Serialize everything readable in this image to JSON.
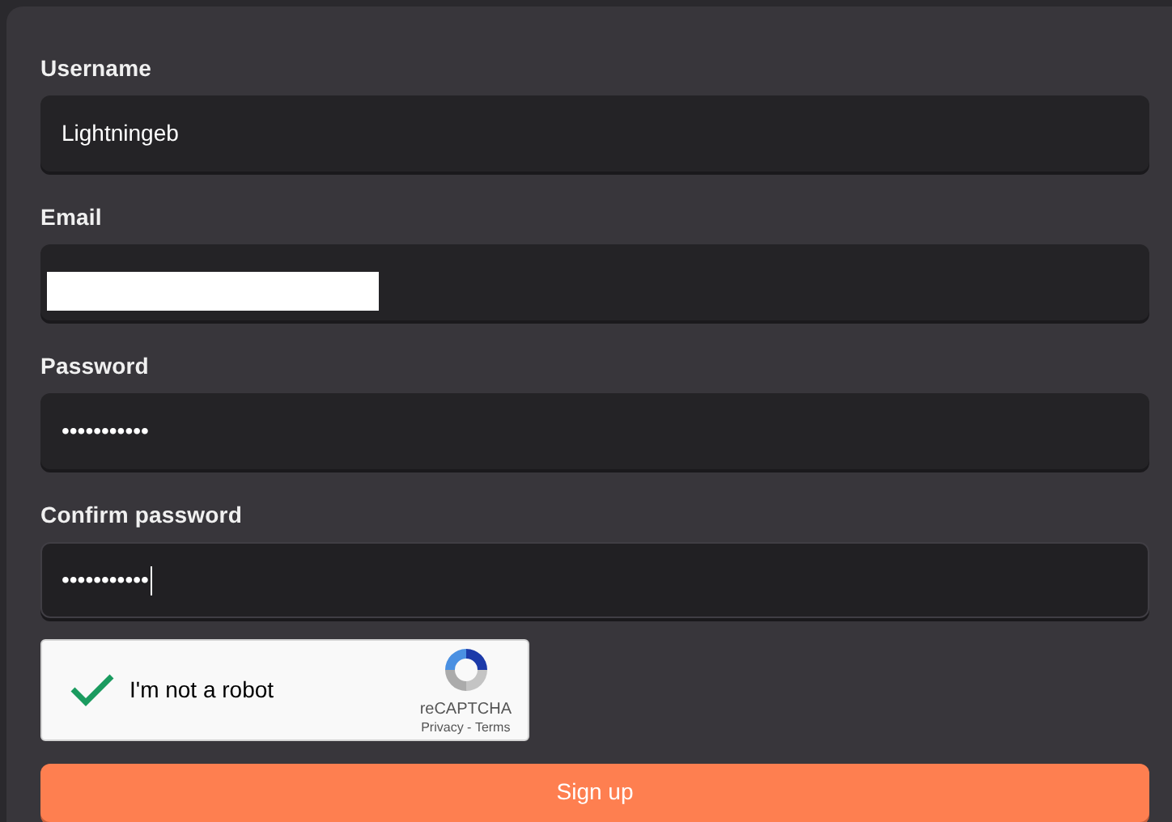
{
  "fields": [
    {
      "label": "Username",
      "value": "Lightningeb",
      "redacted": false,
      "focused": false
    },
    {
      "label": "Email",
      "redacted": true,
      "focused": false
    },
    {
      "label": "Password",
      "value": "•••••••••••",
      "redacted": false,
      "focused": false
    },
    {
      "label": "Confirm password",
      "value": "•••••••••••",
      "redacted": false,
      "focused": true
    }
  ],
  "captcha": {
    "label": "I'm not a robot",
    "checked": true,
    "brand": "reCAPTCHA",
    "privacy": "Privacy",
    "separator": " - ",
    "terms": "Terms"
  },
  "submit": {
    "label": "Sign up"
  }
}
